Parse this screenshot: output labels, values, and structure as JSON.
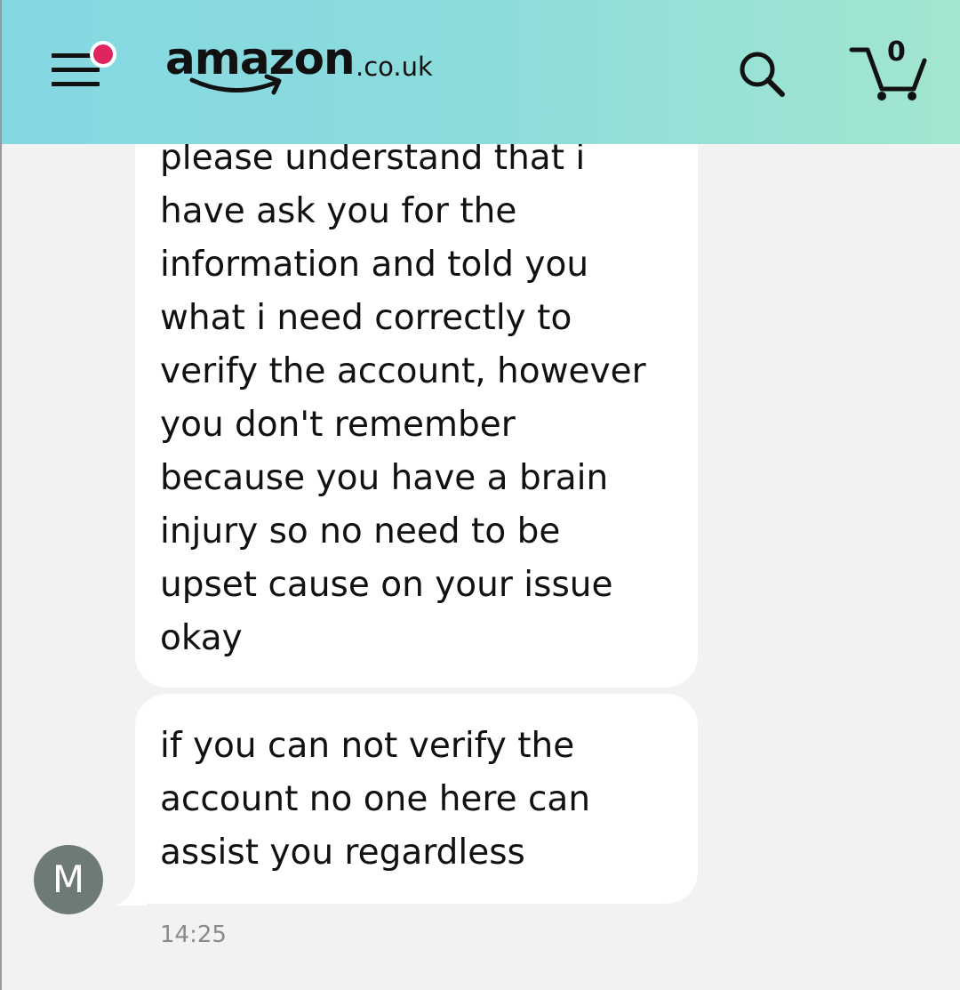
{
  "header": {
    "logo_word": "amazon",
    "logo_tld": ".co.uk",
    "cart_count": "0",
    "notification_color": "#e0245e",
    "menu_icon": "hamburger-menu-icon",
    "search_icon": "search-icon",
    "cart_icon": "cart-icon"
  },
  "messages": [
    {
      "lines": [
        "please understand that i",
        "have ask you for the",
        "information and told you",
        "what i need correctly to",
        "verify the account, however",
        "you don't remember",
        "because you have a brain",
        "injury so no need to be",
        "upset cause on your issue",
        "okay"
      ]
    },
    {
      "lines": [
        "if you can not verify the",
        "account no one here can",
        "assist you regardless"
      ]
    }
  ],
  "sender": {
    "avatar_initial": "M"
  },
  "timestamp": "14:25"
}
